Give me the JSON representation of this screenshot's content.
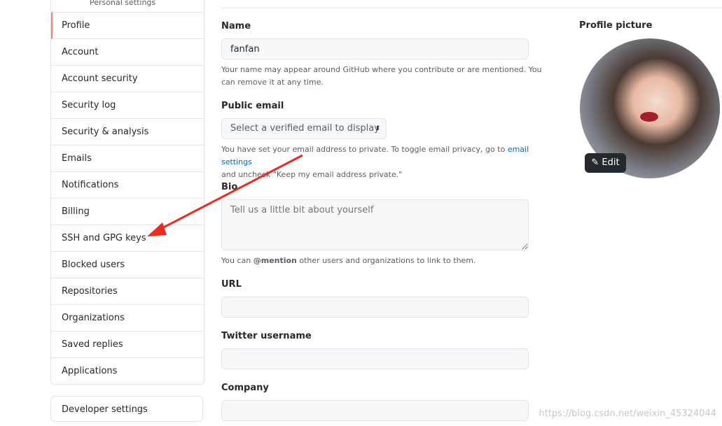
{
  "sidebar": {
    "header": "Personal settings",
    "items": [
      "Profile",
      "Account",
      "Account security",
      "Security log",
      "Security & analysis",
      "Emails",
      "Notifications",
      "Billing",
      "SSH and GPG keys",
      "Blocked users",
      "Repositories",
      "Organizations",
      "Saved replies",
      "Applications"
    ],
    "selected": "Profile",
    "developer": "Developer settings"
  },
  "form": {
    "name_label": "Name",
    "name_value": "fanfan",
    "name_help": "Your name may appear around GitHub where you contribute or are mentioned. You can remove it at any time.",
    "email_label": "Public email",
    "email_select": "Select a verified email to display",
    "email_help_1": "You have set your email address to private. To toggle email privacy, go to",
    "email_link": "email settings",
    "email_help_2": "and uncheck \"Keep my email address private.\"",
    "bio_label": "Bio",
    "bio_placeholder": "Tell us a little bit about yourself",
    "bio_help_1": "You can",
    "bio_help_mention": "@mention",
    "bio_help_2": "other users and organizations to link to them.",
    "url_label": "URL",
    "url_value": "",
    "twitter_label": "Twitter username",
    "twitter_value": "",
    "company_label": "Company",
    "company_value": ""
  },
  "picture": {
    "label": "Profile picture",
    "edit": "Edit"
  },
  "watermark": "https://blog.csdn.net/weixin_45324044",
  "colors": {
    "accent": "#f9826c",
    "link": "#0366d6",
    "arrow": "#f02a1f"
  }
}
